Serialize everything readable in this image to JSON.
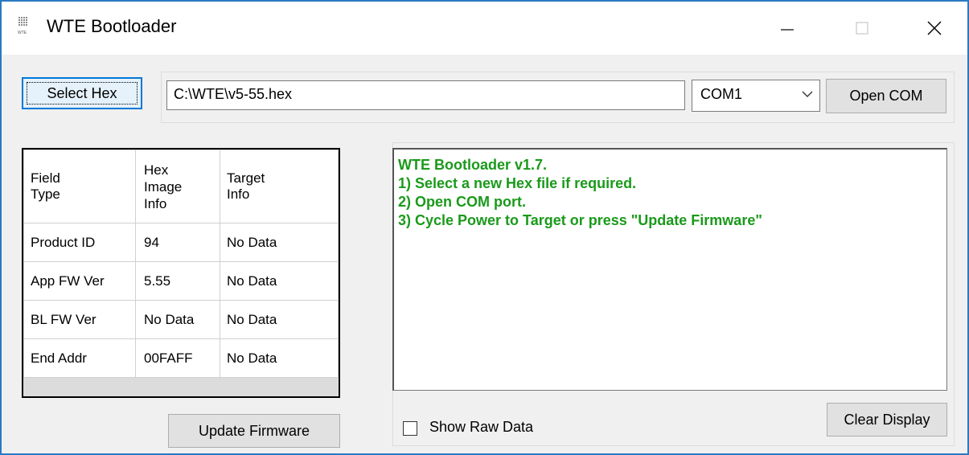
{
  "window": {
    "title": "WTE Bootloader",
    "icon_caption": "WTE",
    "accent_border": "#2b79c2"
  },
  "toolbar": {
    "select_hex_label": "Select Hex",
    "file_path": "C:\\WTE\\v5-55.hex",
    "com_port_value": "COM1",
    "open_com_label": "Open COM"
  },
  "info_table": {
    "headers": [
      "Field\nType",
      "Hex\nImage\nInfo",
      "Target\nInfo"
    ],
    "rows": [
      [
        "Product ID",
        "94",
        "No Data"
      ],
      [
        "App FW Ver",
        "5.55",
        "No Data"
      ],
      [
        "BL FW Ver",
        "No Data",
        "No Data"
      ],
      [
        "End Addr",
        "00FAFF",
        "No Data"
      ]
    ]
  },
  "actions": {
    "update_firmware_label": "Update Firmware",
    "show_raw_data_label": "Show Raw Data",
    "show_raw_data_checked": false,
    "clear_display_label": "Clear Display"
  },
  "log": {
    "text_color": "#1a9a1a",
    "lines": [
      "WTE Bootloader v1.7.",
      "",
      "1) Select a new Hex file if required.",
      "2) Open COM port.",
      "3) Cycle Power to Target or press \"Update Firmware\""
    ]
  }
}
